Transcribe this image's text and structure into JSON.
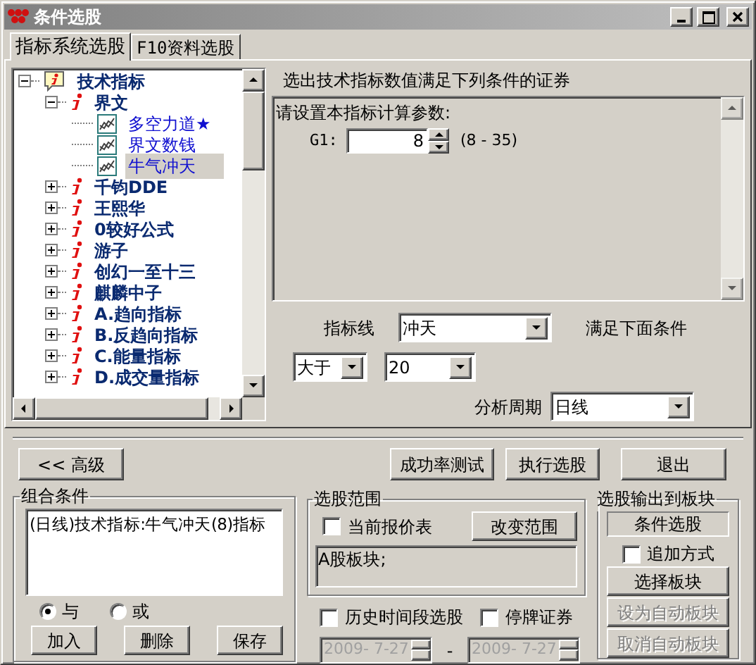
{
  "window": {
    "title": "条件选股"
  },
  "tabs": [
    {
      "label": "指标系统选股",
      "selected": true
    },
    {
      "label": "F10资料选股",
      "selected": false
    }
  ],
  "tree": {
    "label": "技术指标",
    "kind": "root",
    "expanded": true,
    "children": [
      {
        "label": "界文",
        "kind": "group",
        "expanded": true,
        "children": [
          {
            "label": "多空力道★",
            "kind": "formula",
            "selected": false
          },
          {
            "label": "界文数钱",
            "kind": "formula",
            "selected": false
          },
          {
            "label": "牛气冲天",
            "kind": "formula",
            "selected": true
          }
        ]
      },
      {
        "label": "千钧DDE",
        "kind": "group",
        "expanded": false
      },
      {
        "label": "王熙华",
        "kind": "group",
        "expanded": false
      },
      {
        "label": "0较好公式",
        "kind": "group",
        "expanded": false
      },
      {
        "label": "游子",
        "kind": "group",
        "expanded": false
      },
      {
        "label": "创幻一至十三",
        "kind": "group",
        "expanded": false
      },
      {
        "label": "麒麟中子",
        "kind": "group",
        "expanded": false
      },
      {
        "label": "A.趋向指标",
        "kind": "group",
        "expanded": false
      },
      {
        "label": "B.反趋向指标",
        "kind": "group",
        "expanded": false
      },
      {
        "label": "C.能量指标",
        "kind": "group",
        "expanded": false
      },
      {
        "label": "D.成交量指标",
        "kind": "group",
        "expanded": false
      }
    ]
  },
  "criteria": {
    "heading": "选出技术指标数值满足下列条件的证券",
    "param_box": {
      "title": "请设置本指标计算参数:",
      "params": [
        {
          "label": "G1:",
          "value": "8",
          "range": "(8 - 35)"
        }
      ]
    },
    "line_label": "指标线",
    "line": "冲天",
    "condition_label": "满足下面条件",
    "operator": "大于",
    "threshold": "20",
    "period_label": "分析周期",
    "period": "日线"
  },
  "advanced_button": "<< 高级",
  "action_buttons": [
    "成功率测试",
    "执行选股",
    "退出"
  ],
  "combined": {
    "title": "组合条件",
    "items": [
      "(日线)技术指标:牛气冲天(8)指标"
    ],
    "logic": [
      {
        "label": "与",
        "selected": true
      },
      {
        "label": "或",
        "selected": false
      }
    ],
    "buttons": [
      "加入",
      "删除",
      "保存"
    ]
  },
  "scope": {
    "title": "选股范围",
    "current_quote": {
      "label": "当前报价表",
      "checked": false
    },
    "change_button": "改变范围",
    "blocks": "A股板块;"
  },
  "history": {
    "label": "历史时间段选股",
    "checked": false
  },
  "suspended": {
    "label": "停牌证券",
    "checked": false
  },
  "date_from": {
    "value": "2009- 7-27",
    "disabled": true
  },
  "date_separator": "-",
  "date_to": {
    "value": "2009- 7-27",
    "disabled": true
  },
  "output": {
    "title": "选股输出到板块",
    "block_name": "条件选股",
    "append": {
      "label": "追加方式",
      "checked": false
    },
    "buttons": [
      {
        "label": "选择板块",
        "disabled": false
      },
      {
        "label": "设为自动板块",
        "disabled": true
      },
      {
        "label": "取消自动板块",
        "disabled": true
      }
    ]
  }
}
